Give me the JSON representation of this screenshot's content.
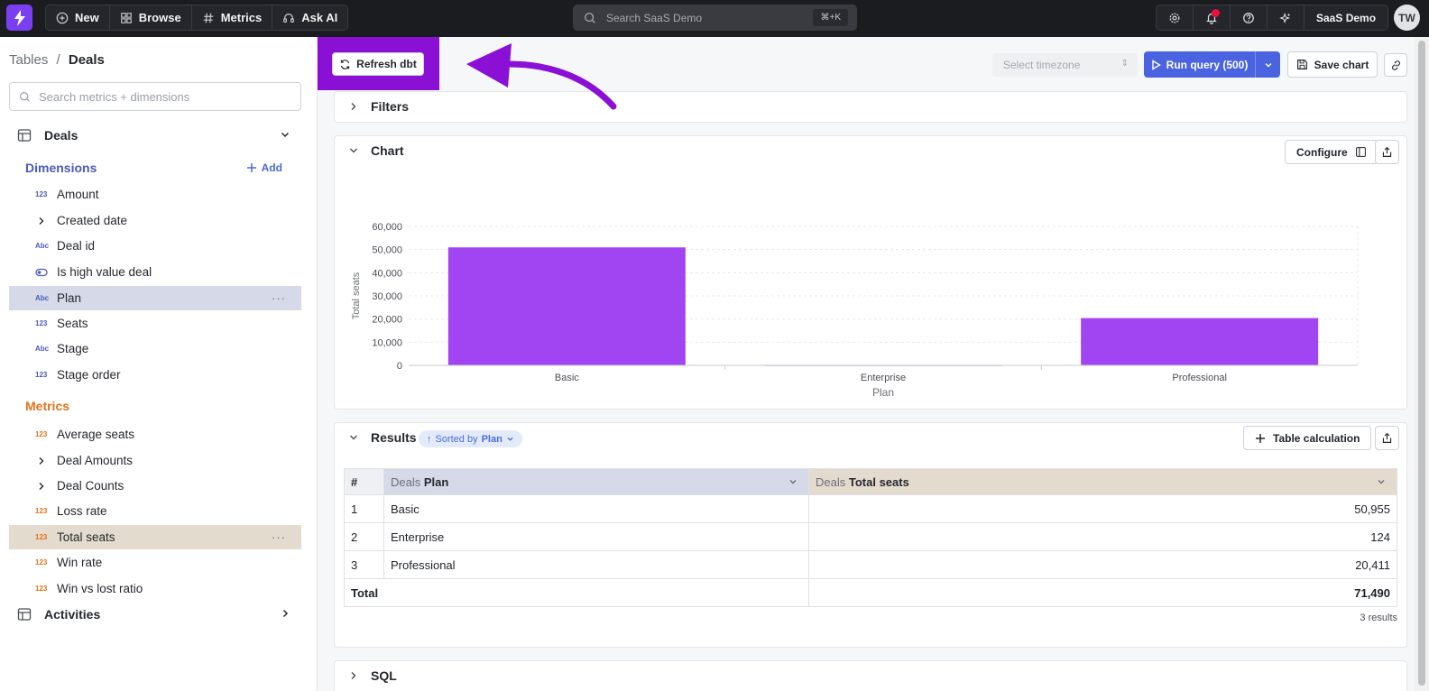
{
  "topbar": {
    "new_label": "New",
    "browse_label": "Browse",
    "metrics_label": "Metrics",
    "askai_label": "Ask AI",
    "search_placeholder": "Search SaaS Demo",
    "search_shortcut": "⌘+K",
    "org_label": "SaaS Demo",
    "avatar_initials": "TW"
  },
  "sidebar": {
    "breadcrumb_root": "Tables",
    "breadcrumb_sep": "/",
    "breadcrumb_current": "Deals",
    "search_placeholder": "Search metrics + dimensions",
    "table_deals": "Deals",
    "dimensions_heading": "Dimensions",
    "add_label": "Add",
    "dimensions": [
      {
        "label": "Amount",
        "type": "123"
      },
      {
        "label": "Created date",
        "type": "group"
      },
      {
        "label": "Deal id",
        "type": "Abc"
      },
      {
        "label": "Is high value deal",
        "type": "bool"
      },
      {
        "label": "Plan",
        "type": "Abc",
        "selected": true
      },
      {
        "label": "Seats",
        "type": "123"
      },
      {
        "label": "Stage",
        "type": "Abc"
      },
      {
        "label": "Stage order",
        "type": "123"
      }
    ],
    "metrics_heading": "Metrics",
    "metrics": [
      {
        "label": "Average seats",
        "type": "123"
      },
      {
        "label": "Deal Amounts",
        "type": "group"
      },
      {
        "label": "Deal Counts",
        "type": "group"
      },
      {
        "label": "Loss rate",
        "type": "123"
      },
      {
        "label": "Total seats",
        "type": "123",
        "selected": true
      },
      {
        "label": "Win rate",
        "type": "123"
      },
      {
        "label": "Win vs lost ratio",
        "type": "123"
      }
    ],
    "table_activities": "Activities"
  },
  "toolbar": {
    "refresh_label": "Refresh dbt",
    "timezone_placeholder": "Select timezone",
    "run_label": "Run query (500)",
    "save_label": "Save chart"
  },
  "filters": {
    "title": "Filters"
  },
  "chart_card": {
    "title": "Chart",
    "configure_label": "Configure"
  },
  "chart_data": {
    "type": "bar",
    "categories": [
      "Basic",
      "Enterprise",
      "Professional"
    ],
    "values": [
      50955,
      124,
      20411
    ],
    "xlabel": "Plan",
    "ylabel": "Total seats",
    "ylim": [
      0,
      60000
    ],
    "yticks": [
      "0",
      "10,000",
      "20,000",
      "30,000",
      "40,000",
      "50,000",
      "60,000"
    ],
    "bar_color": "#a144f2",
    "grid": true
  },
  "results": {
    "title": "Results",
    "sorted_prefix": "Sorted by",
    "sorted_field": "Plan",
    "table_calc_label": "Table calculation",
    "col_index": "#",
    "col_plan_table": "Deals",
    "col_plan_field": "Plan",
    "col_seats_table": "Deals",
    "col_seats_field": "Total seats",
    "rows": [
      {
        "idx": "1",
        "plan": "Basic",
        "seats": "50,955"
      },
      {
        "idx": "2",
        "plan": "Enterprise",
        "seats": "124"
      },
      {
        "idx": "3",
        "plan": "Professional",
        "seats": "20,411"
      }
    ],
    "total_label": "Total",
    "total_value": "71,490",
    "count_label": "3 results"
  },
  "sql": {
    "title": "SQL"
  },
  "colors": {
    "accent": "#4a63e0",
    "highlight": "#8a10d6",
    "dimension": "#4b5ab8",
    "metric": "#e4711a"
  }
}
